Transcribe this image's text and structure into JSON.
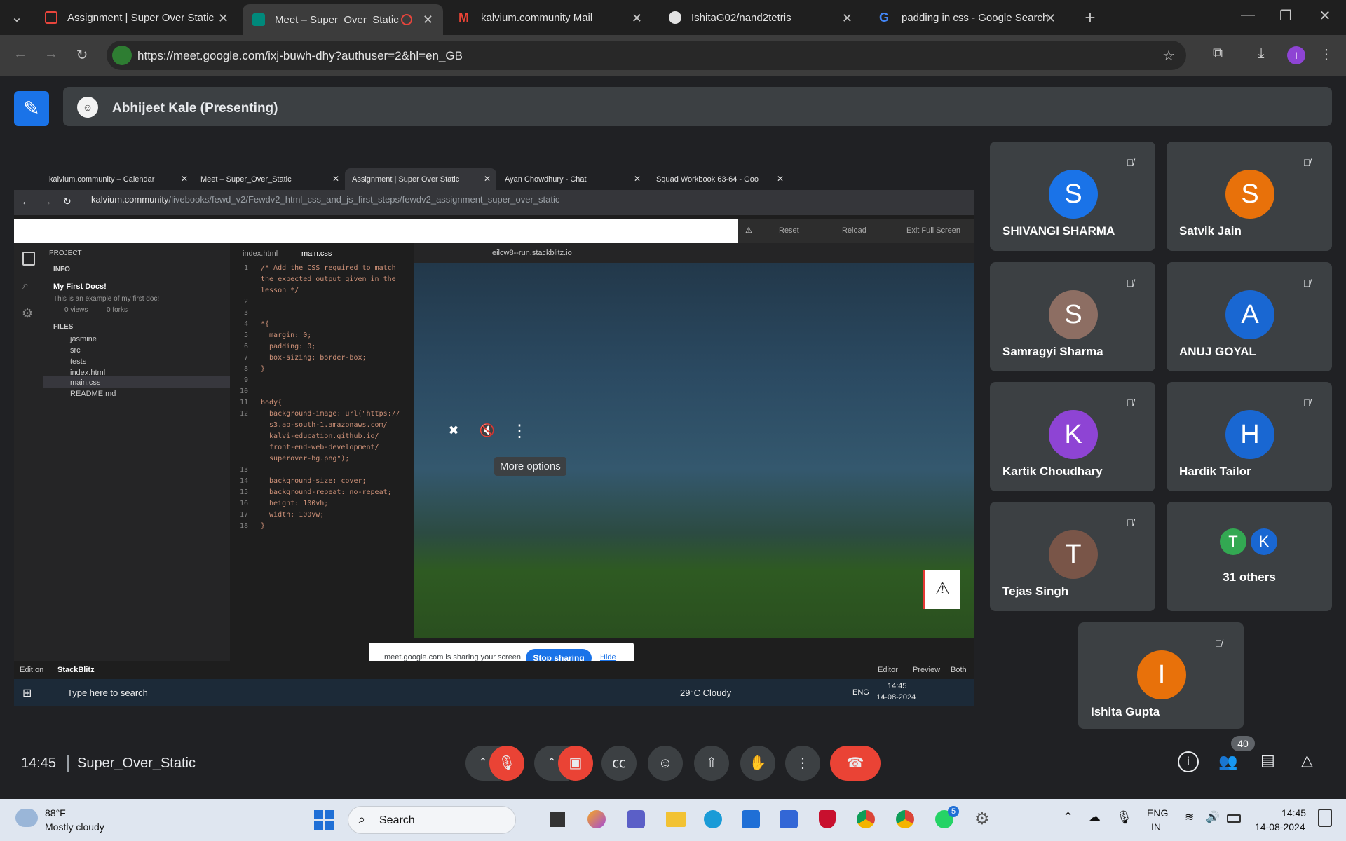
{
  "browser": {
    "tabs": [
      {
        "label": "Assignment | Super Over Static"
      },
      {
        "label": "Meet – Super_Over_Static"
      },
      {
        "label": "kalvium.community Mail"
      },
      {
        "label": "IshitaG02/nand2tetris"
      },
      {
        "label": "padding in css - Google Search"
      }
    ],
    "url": "https://meet.google.com/ixj-buwh-dhy?authuser=2&hl=en_GB"
  },
  "meet": {
    "presenter": "Abhijeet Kale (Presenting)",
    "meeting_time": "14:45",
    "meeting_name": "Super_Over_Static",
    "participant_count": "40",
    "tooltip": "More options",
    "participants": [
      {
        "initial": "S",
        "name": "SHIVANGI SHARMA",
        "color": "#1a73e8"
      },
      {
        "initial": "S",
        "name": "Satvik Jain",
        "color": "#e8710a"
      },
      {
        "initial": "S",
        "name": "Samragyi Sharma",
        "color": "#8d6e63"
      },
      {
        "initial": "A",
        "name": "ANUJ GOYAL",
        "color": "#1967d2"
      },
      {
        "initial": "K",
        "name": "Kartik Choudhary",
        "color": "#8e44d4"
      },
      {
        "initial": "H",
        "name": "Hardik Tailor",
        "color": "#1967d2"
      },
      {
        "initial": "T",
        "name": "Tejas Singh",
        "color": "#795548"
      },
      {
        "initial": "I",
        "name": "Ishita Gupta",
        "color": "#e8710a"
      }
    ],
    "others": {
      "label": "31 others",
      "a": "T",
      "b": "K",
      "a_color": "#33a852",
      "b_color": "#1967d2"
    }
  },
  "shared": {
    "tabs": [
      {
        "label": "kalvium.community – Calendar"
      },
      {
        "label": "Meet – Super_Over_Static"
      },
      {
        "label": "Assignment | Super Over Static"
      },
      {
        "label": "Ayan Chowdhury - Chat"
      },
      {
        "label": "Squad Workbook 63-64 - Goo"
      }
    ],
    "url_host": "kalvium.community",
    "url_path": "/livebooks/fewd_v2/Fewdv2_html_css_and_js_first_steps/fewdv2_assignment_super_over_static",
    "tools": {
      "reset": "Reset",
      "reload": "Reload",
      "exit": "Exit Full Screen"
    },
    "project": {
      "title": "PROJECT",
      "info": "INFO",
      "doc_title": "My First Docs!",
      "doc_desc": "This is an example of my first doc!",
      "views": "0 views",
      "forks": "0 forks",
      "files": "FILES",
      "file_list": [
        "jasmine",
        "src",
        "tests",
        "index.html",
        "main.css",
        "README.md"
      ]
    },
    "editor_tabs": [
      "index.html",
      "main.css"
    ],
    "preview_url": "eilcw8--run.stackblitz.io",
    "code": [
      {
        "n": "1",
        "t": "/* Add the CSS required to match"
      },
      {
        "n": "",
        "t": "the expected output given in the"
      },
      {
        "n": "",
        "t": "lesson */"
      },
      {
        "n": "2",
        "t": ""
      },
      {
        "n": "3",
        "t": ""
      },
      {
        "n": "4",
        "t": "*{"
      },
      {
        "n": "5",
        "t": "  margin: 0;"
      },
      {
        "n": "6",
        "t": "  padding: 0;"
      },
      {
        "n": "7",
        "t": "  box-sizing: border-box;"
      },
      {
        "n": "8",
        "t": "}"
      },
      {
        "n": "9",
        "t": ""
      },
      {
        "n": "10",
        "t": ""
      },
      {
        "n": "11",
        "t": "body{"
      },
      {
        "n": "12",
        "t": "  background-image: url(\"https://"
      },
      {
        "n": "",
        "t": "  s3.ap-south-1.amazonaws.com/"
      },
      {
        "n": "",
        "t": "  kalvi-education.github.io/"
      },
      {
        "n": "",
        "t": "  front-end-web-development/"
      },
      {
        "n": "",
        "t": "  superover-bg.png\");"
      },
      {
        "n": "13",
        "t": ""
      },
      {
        "n": "14",
        "t": "  background-size: cover;"
      },
      {
        "n": "15",
        "t": "  background-repeat: no-repeat;"
      },
      {
        "n": "16",
        "t": "  height: 100vh;"
      },
      {
        "n": "17",
        "t": "  width: 100vw;"
      },
      {
        "n": "18",
        "t": "}"
      }
    ],
    "footer": {
      "edit_on": "Edit on",
      "brand": "StackBlitz",
      "editor": "Editor",
      "preview": "Preview",
      "both": "Both"
    },
    "share_notice": {
      "text": "meet.google.com is sharing your screen.",
      "stop": "Stop sharing",
      "hide": "Hide"
    },
    "taskbar": {
      "search": "Type here to search",
      "weather": "29°C Cloudy",
      "lang": "ENG",
      "time": "14:45",
      "date": "14-08-2024"
    }
  },
  "windows": {
    "weather_temp": "88°F",
    "weather_desc": "Mostly cloudy",
    "search": "Search",
    "lang1": "ENG",
    "lang2": "IN",
    "time": "14:45",
    "date": "14-08-2024",
    "whatsapp_badge": "5"
  }
}
